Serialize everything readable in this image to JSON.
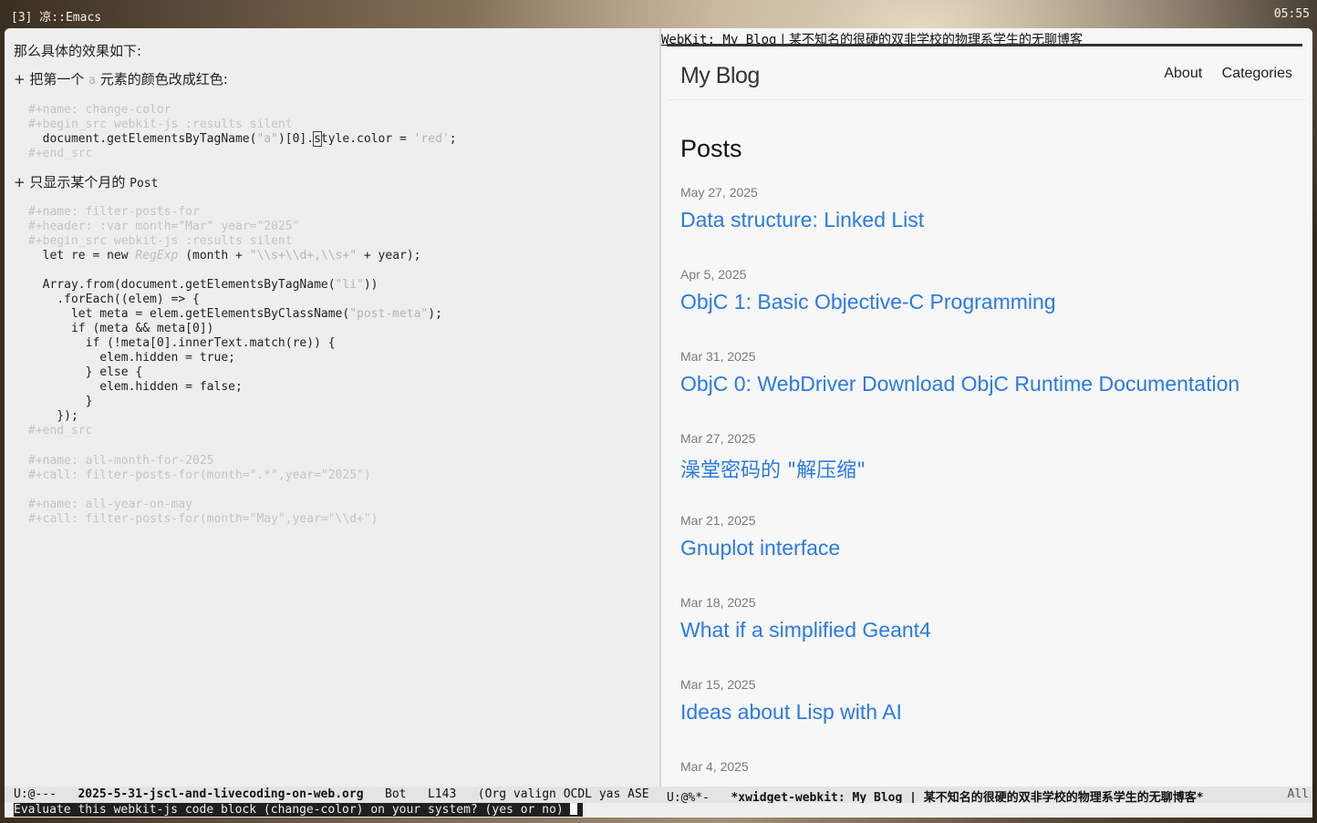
{
  "topbar": {
    "title": "[3] 凉::Emacs",
    "clock": "05:55"
  },
  "org": {
    "intro": "那么具体的效果如下:",
    "item1": {
      "bullet": "+",
      "text_before": "把第一个 ",
      "code": "a",
      "text_after": " 元素的颜色改成红色:"
    },
    "block1": {
      "name": "#+name: change-color",
      "begin": "#+begin_src webkit-js :results silent",
      "code_pre": "  document.getElementsByTagName(",
      "code_str": "\"a\"",
      "code_mid": ")[0].",
      "code_cursor": "s",
      "code_mid2": "tyle.color = ",
      "code_str2": "'red'",
      "code_end": ";",
      "end": "#+end_src"
    },
    "item2": {
      "bullet": "+",
      "text": "只显示某个月的 ",
      "latin": "Post"
    },
    "block2": {
      "name": "#+name: filter-posts-for",
      "header": "#+header: :var month=\"Mar\" year=\"2025\"",
      "begin": "#+begin_src webkit-js :results silent",
      "l1_pre": "  let re = new ",
      "l1_type": "RegExp",
      "l1_mid": " (month + ",
      "l1_str": "\"\\\\s+\\\\d+,\\\\s+\"",
      "l1_end": " + year);",
      "l2_pre": "  Array.from(document.getElementsByTagName(",
      "l2_str": "\"li\"",
      "l2_end": "))",
      "l3": "    .forEach((elem) => {",
      "l4_pre": "      let meta = elem.getElementsByClassName(",
      "l4_str": "\"post-meta\"",
      "l4_end": ");",
      "l5": "      if (meta && meta[0])",
      "l6": "        if (!meta[0].innerText.match(re)) {",
      "l7": "          elem.hidden = true;",
      "l8": "        } else {",
      "l9": "          elem.hidden = false;",
      "l10": "        }",
      "l11": "    });",
      "end": "#+end_src"
    },
    "block3": {
      "name": "#+name: all-month-for-2025",
      "call": "#+call: filter-posts-for(month=\".*\",year=\"2025\")"
    },
    "block4": {
      "name": "#+name: all-year-on-may",
      "call": "#+call: filter-posts-for(month=\"May\",year=\"\\\\d+\")"
    }
  },
  "webkit": {
    "header_prefix": "WebKit: My Blog",
    "header_suffix": " | 某不知名的很硬的双非学校的物理系学生的无聊博客",
    "site_title": "My Blog",
    "nav": [
      {
        "label": "About"
      },
      {
        "label": "Categories"
      }
    ],
    "page_heading": "Posts",
    "posts": [
      {
        "date": "May 27, 2025",
        "title": "Data structure: Linked List"
      },
      {
        "date": "Apr 5, 2025",
        "title": "ObjC 1: Basic Objective-C Programming"
      },
      {
        "date": "Mar 31, 2025",
        "title": "ObjC 0: WebDriver Download ObjC Runtime Documentation"
      },
      {
        "date": "Mar 27, 2025",
        "title": "澡堂密码的 \"解压缩\""
      },
      {
        "date": "Mar 21, 2025",
        "title": "Gnuplot interface"
      },
      {
        "date": "Mar 18, 2025",
        "title": "What if a simplified Geant4"
      },
      {
        "date": "Mar 15, 2025",
        "title": "Ideas about Lisp with AI"
      },
      {
        "date": "Mar 4, 2025",
        "title": ""
      }
    ]
  },
  "modeline": {
    "left_state": "U:@---",
    "left_file": "2025-5-31-jscl-and-livecoding-on-web.org",
    "left_pos": "Bot",
    "left_line": "L143",
    "left_modes": "(Org valign OCDL yas ASE",
    "right_state": "U:@%*-",
    "right_buffer": "*xwidget-webkit: My Blog | 某不知名的很硬的双非学校的物理系学生的无聊博客*",
    "right_pos": "All"
  },
  "echo": {
    "message": "Evaluate this webkit-js code block (change-color) on your system? (yes or no) "
  }
}
